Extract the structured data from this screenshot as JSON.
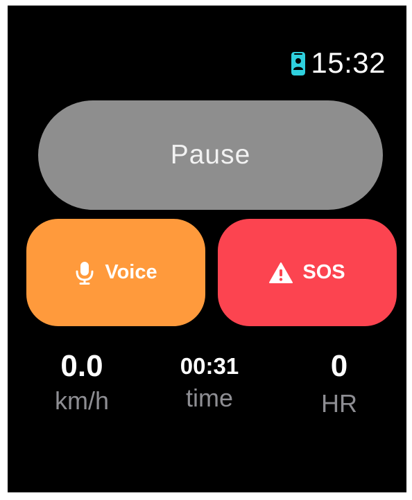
{
  "colors": {
    "background": "#000000",
    "pause": "#8e8e8e",
    "voice": "#ff9a3c",
    "sos": "#fc4450",
    "accent_phone": "#2fd0de",
    "unit_text": "#8e8e93"
  },
  "status_bar": {
    "phone_icon": "phone-icon",
    "time": "15:32"
  },
  "controls": {
    "pause_label": "Pause",
    "voice_label": "Voice",
    "voice_icon": "microphone-icon",
    "sos_label": "SOS",
    "sos_icon": "warning-icon"
  },
  "metrics": {
    "speed_value": "0.0",
    "speed_unit": "km/h",
    "time_value": "00:31",
    "time_unit": "time",
    "hr_value": "0",
    "hr_unit": "HR"
  }
}
